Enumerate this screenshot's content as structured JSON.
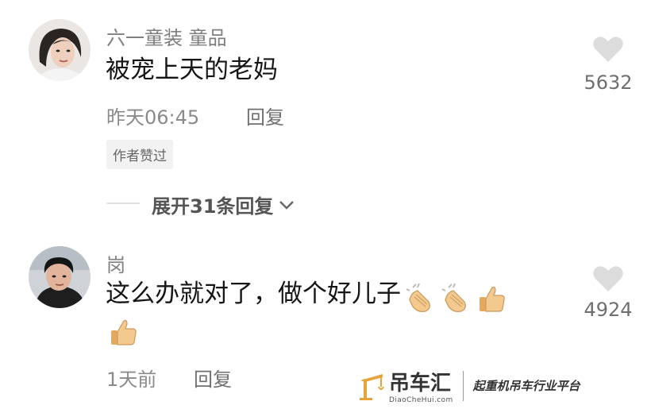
{
  "comments": [
    {
      "username": "六一童装 童品",
      "content": "被宠上天的老妈",
      "time": "昨天06:45",
      "reply_label": "回复",
      "badge": "作者赞过",
      "likes": "5632",
      "like_icon": "heart-icon"
    },
    {
      "username": "岗",
      "content": "这么办就对了，做个好儿子",
      "emojis": [
        "clapping-hands-emoji",
        "clapping-hands-emoji",
        "thumbs-up-emoji",
        "thumbs-up-emoji"
      ],
      "time": "1天前",
      "reply_label": "回复",
      "likes": "4924",
      "like_icon": "heart-icon"
    }
  ],
  "expand_replies": {
    "label": "展开31条回复",
    "icon": "chevron-down-icon"
  },
  "watermark": {
    "title": "吊车汇",
    "site": "DiaoCheHui.com",
    "slogan": "起重机吊车行业平台",
    "accent": "#e8a33a"
  }
}
